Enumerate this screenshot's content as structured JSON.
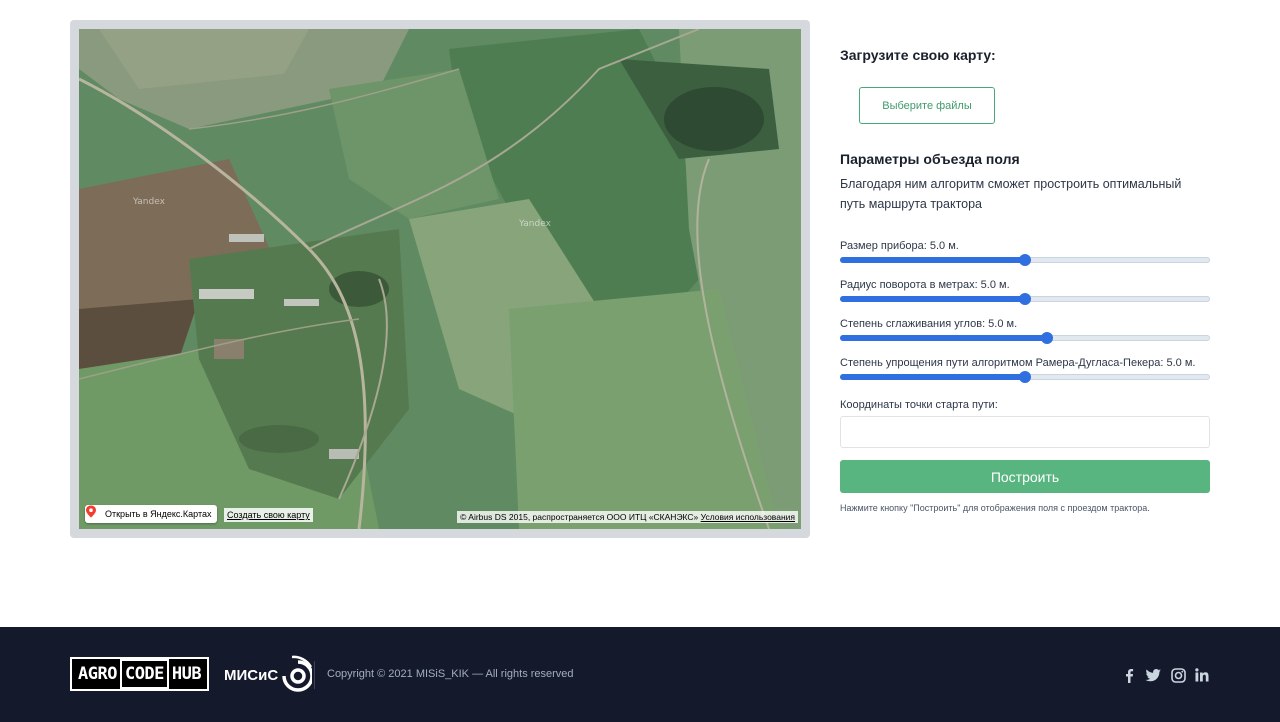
{
  "map": {
    "watermark": "Yandex",
    "open_in_yandex": "Открыть в Яндекс.Картах",
    "create_map": "Создать свою карту",
    "copyright": "© Airbus DS 2015, распространяется ООО ИТЦ «СКАНЭКС»",
    "terms": "Условия использования"
  },
  "upload": {
    "title": "Загрузите свою карту:",
    "button": "Выберите файлы"
  },
  "params": {
    "title": "Параметры объезда поля",
    "description": "Благодаря ним алгоритм сможет простроить оптимальный путь маршрута трактора",
    "sliders": [
      {
        "label": "Размер прибора: 5.0 м.",
        "fraction": 0.5
      },
      {
        "label": "Радиус поворота в метрах: 5.0 м.",
        "fraction": 0.5
      },
      {
        "label": "Степень сглаживания углов: 5.0 м.",
        "fraction": 0.56
      },
      {
        "label": "Степень упрощения пути алгоритмом Рамера-Дугласа-Пекера: 5.0 м.",
        "fraction": 0.5
      }
    ],
    "coord_label": "Координаты точки старта пути:",
    "coord_value": "",
    "build_button": "Построить",
    "hint": "Нажмите кнопку \"Построить\" для отображения поля с проездом трактора."
  },
  "footer": {
    "logo_parts": [
      "AGRO",
      "CODE",
      "HUB"
    ],
    "misis": "МИСиС",
    "copyright": "Copyright © 2021 MISiS_KIK — All rights reserved",
    "social_icons": [
      "facebook-icon",
      "twitter-icon",
      "instagram-icon",
      "linkedin-icon"
    ]
  },
  "colors": {
    "accent_green": "#58b580",
    "slider_blue": "#2f6fe0",
    "footer_bg": "#141a2b"
  }
}
